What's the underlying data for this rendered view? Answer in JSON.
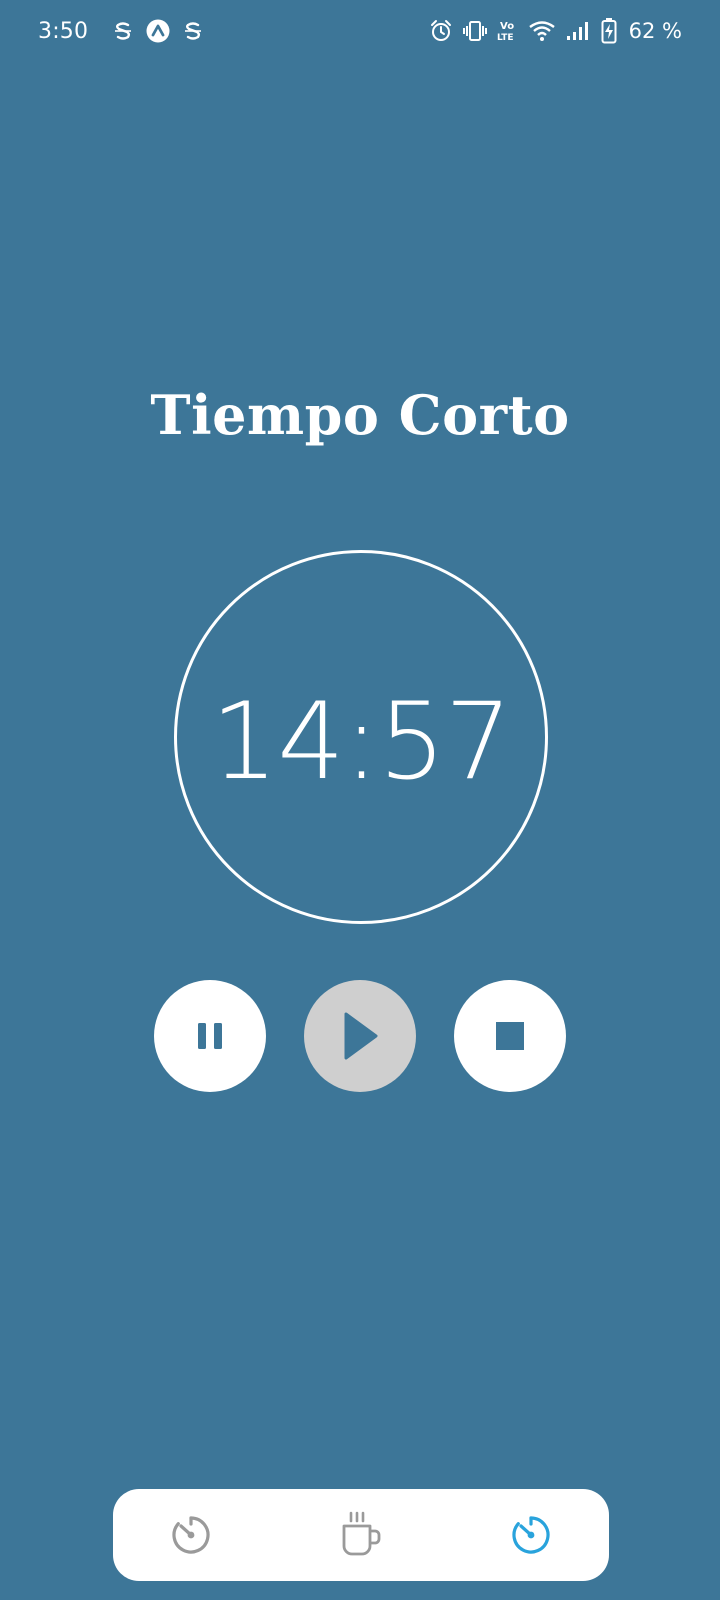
{
  "status_bar": {
    "time": "3:50",
    "battery": "62 %",
    "notification_icons": [
      "s-app-icon",
      "arc-app-icon",
      "s-app-icon"
    ],
    "system_icons": [
      "alarm-icon",
      "vibrate-icon",
      "volte-icon",
      "wifi-icon",
      "signal-icon",
      "battery-charging-icon"
    ]
  },
  "mode": {
    "title": "Tiempo Corto"
  },
  "timer": {
    "value": "14:57"
  },
  "controls": {
    "pause_icon": "pause-icon",
    "play_icon": "play-icon",
    "stop_icon": "stop-icon",
    "active": "play"
  },
  "bottom_nav": {
    "items": [
      {
        "icon": "timer-icon",
        "active": false
      },
      {
        "icon": "coffee-cup-icon",
        "active": false
      },
      {
        "icon": "timer-icon",
        "active": true
      }
    ]
  },
  "colors": {
    "background": "#3D7698",
    "accent": "#29A3DC",
    "icon_inactive": "#9A9A9A",
    "button_bg": "#FFFFFF",
    "active_button_bg": "#CFCFCF"
  }
}
